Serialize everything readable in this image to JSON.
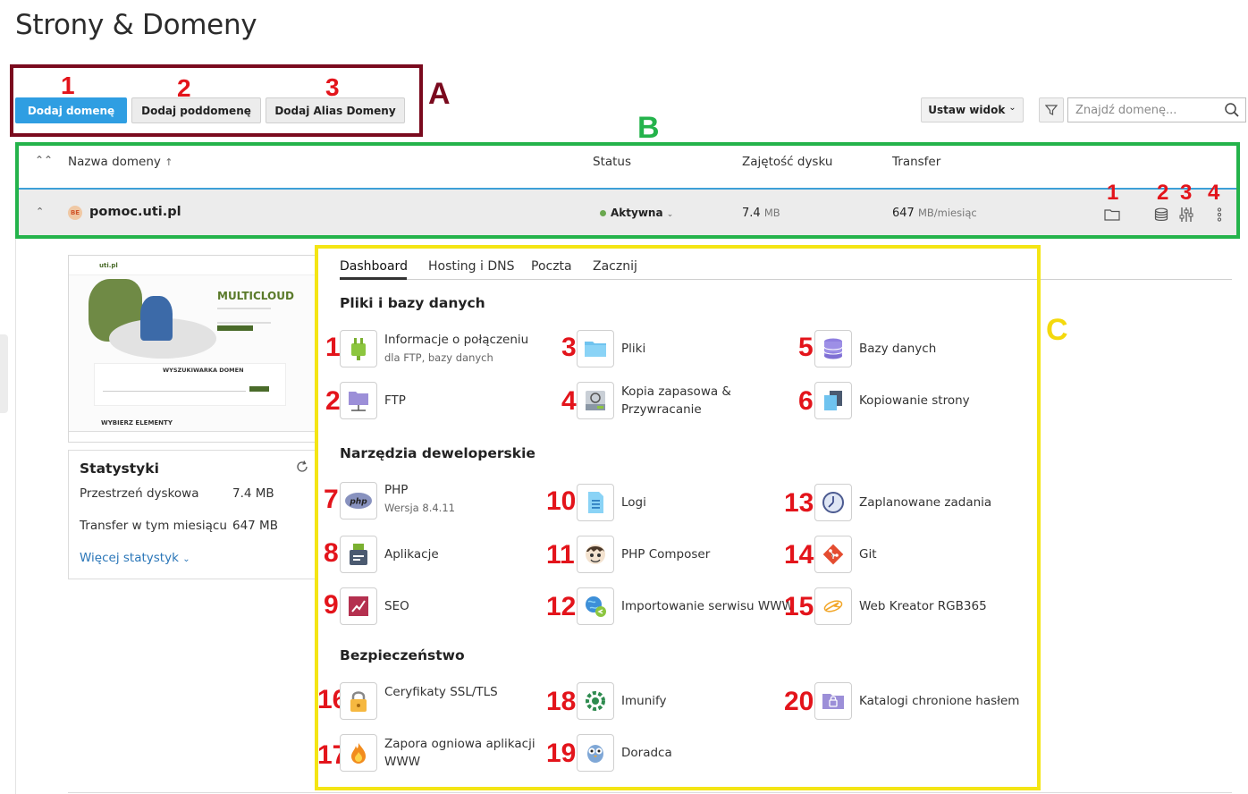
{
  "page": {
    "title": "Strony & Domeny"
  },
  "buttons": {
    "add_domain": "Dodaj domenę",
    "add_subdomain": "Dodaj poddomenę",
    "add_alias": "Dodaj Alias Domeny",
    "set_view": "Ustaw widok",
    "set_view_caret": "⌄"
  },
  "search": {
    "placeholder": "Znajdź domenę..."
  },
  "annotations": {
    "a": "A",
    "b": "B",
    "c": "C",
    "a_nums": [
      "1",
      "2",
      "3"
    ],
    "b_nums": [
      "1",
      "2",
      "3",
      "4"
    ]
  },
  "table": {
    "headers": {
      "name": "Nazwa domeny",
      "sort_arrow": "↑",
      "status": "Status",
      "disk": "Zajętość dysku",
      "transfer": "Transfer"
    },
    "row": {
      "favicon": "BE",
      "domain": "pomoc.uti.pl",
      "status": "Aktywna",
      "disk_value": "7.4",
      "disk_unit": "MB",
      "transfer_value": "647",
      "transfer_unit": "MB/miesiąc"
    }
  },
  "preview": {
    "brand": "uti.pl",
    "headline": "MULTICLOUD",
    "search_title": "WYSZUKIWARKA DOMEN",
    "bottom_text": "WYBIERZ ELEMENTY"
  },
  "stats": {
    "title": "Statystyki",
    "disk_label": "Przestrzeń dyskowa",
    "disk_value": "7.4 MB",
    "transfer_label": "Transfer w tym miesiącu",
    "transfer_value": "647 MB",
    "more": "Więcej statystyk"
  },
  "tabs": [
    "Dashboard",
    "Hosting i DNS",
    "Poczta",
    "Zacznij"
  ],
  "sections": {
    "files": "Pliki i bazy danych",
    "dev": "Narzędzia deweloperskie",
    "security": "Bezpieczeństwo"
  },
  "tiles": [
    {
      "num": "1",
      "label": "Informacje o połączeniu",
      "sub": "dla FTP, bazy danych",
      "icon": "plug-icon"
    },
    {
      "num": "2",
      "label": "FTP",
      "sub": "",
      "icon": "ftp-folder-icon"
    },
    {
      "num": "3",
      "label": "Pliki",
      "sub": "",
      "icon": "folder-icon"
    },
    {
      "num": "4",
      "label": "Kopia zapasowa & Przywracanie",
      "sub": "",
      "icon": "backup-icon"
    },
    {
      "num": "5",
      "label": "Bazy danych",
      "sub": "",
      "icon": "database-icon"
    },
    {
      "num": "6",
      "label": "Kopiowanie strony",
      "sub": "",
      "icon": "copy-site-icon"
    },
    {
      "num": "7",
      "label": "PHP",
      "sub": "Wersja 8.4.11",
      "icon": "php-icon"
    },
    {
      "num": "8",
      "label": "Aplikacje",
      "sub": "",
      "icon": "applications-icon"
    },
    {
      "num": "9",
      "label": "SEO",
      "sub": "",
      "icon": "seo-icon"
    },
    {
      "num": "10",
      "label": "Logi",
      "sub": "",
      "icon": "logs-icon"
    },
    {
      "num": "11",
      "label": "PHP Composer",
      "sub": "",
      "icon": "composer-icon"
    },
    {
      "num": "12",
      "label": "Importowanie serwisu WWW",
      "sub": "",
      "icon": "import-site-icon"
    },
    {
      "num": "13",
      "label": "Zaplanowane zadania",
      "sub": "",
      "icon": "clock-icon"
    },
    {
      "num": "14",
      "label": "Git",
      "sub": "",
      "icon": "git-icon"
    },
    {
      "num": "15",
      "label": "Web Kreator RGB365",
      "sub": "",
      "icon": "web-creator-icon"
    },
    {
      "num": "16",
      "label": "Ceryfikaty SSL/TLS",
      "sub": "",
      "icon": "lock-icon"
    },
    {
      "num": "17",
      "label": "Zapora ogniowa aplikacji WWW",
      "sub": "",
      "icon": "firewall-icon"
    },
    {
      "num": "18",
      "label": "Imunify",
      "sub": "",
      "icon": "imunify-icon"
    },
    {
      "num": "19",
      "label": "Doradca",
      "sub": "",
      "icon": "advisor-icon"
    },
    {
      "num": "20",
      "label": "Katalogi chronione hasłem",
      "sub": "",
      "icon": "protected-folder-icon"
    }
  ],
  "colors": {
    "primary_button": "#2f9ee2",
    "annotation_red": "#e3141b",
    "box_a": "#7a0a1e",
    "box_b": "#24b34b",
    "box_c": "#f4e514",
    "status_active": "#6aa84f"
  }
}
